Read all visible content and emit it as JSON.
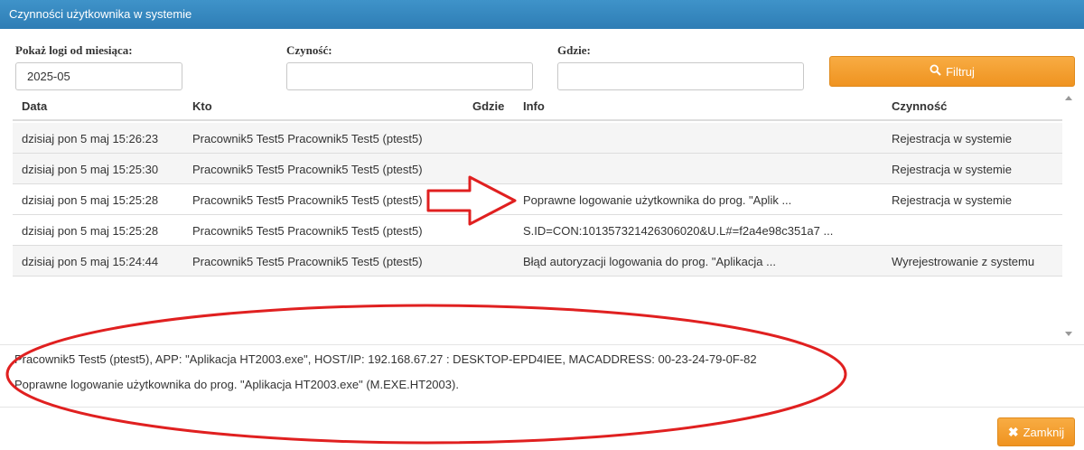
{
  "window": {
    "title": "Czynności użytkownika w systemie"
  },
  "filters": {
    "month_label": "Pokaż logi od miesiąca:",
    "month_value": "2025-05",
    "action_label": "Czyność:",
    "action_value": "",
    "where_label": "Gdzie:",
    "where_value": "",
    "filter_button": "Filtruj"
  },
  "table": {
    "headers": {
      "date": "Data",
      "who": "Kto",
      "where": "Gdzie",
      "info": "Info",
      "action": "Czynność"
    },
    "rows": [
      {
        "date": "dzisiaj pon 5 maj 15:26:23",
        "who": "Pracownik5 Test5 Pracownik5 Test5 (ptest5)",
        "where": "",
        "info": "",
        "action": "Rejestracja w systemie"
      },
      {
        "date": "dzisiaj pon 5 maj 15:25:30",
        "who": "Pracownik5 Test5 Pracownik5 Test5 (ptest5)",
        "where": "",
        "info": "",
        "action": "Rejestracja w systemie"
      },
      {
        "date": "dzisiaj pon 5 maj 15:25:28",
        "who": "Pracownik5 Test5 Pracownik5 Test5 (ptest5)",
        "where": "",
        "info": "Poprawne logowanie użytkownika do prog. \"Aplik ...",
        "action": "Rejestracja w systemie"
      },
      {
        "date": "dzisiaj pon 5 maj 15:25:28",
        "who": "Pracownik5 Test5 Pracownik5 Test5 (ptest5)",
        "where": "",
        "info": "S.ID=CON:101357321426306020&U.L#=f2a4e98c351a7 ...",
        "action": ""
      },
      {
        "date": "dzisiaj pon 5 maj 15:24:44",
        "who": "Pracownik5 Test5 Pracownik5 Test5 (ptest5)",
        "where": "",
        "info": "Błąd autoryzacji logowania do prog. \"Aplikacja ...",
        "action": "Wyrejestrowanie z systemu"
      }
    ]
  },
  "details": {
    "line1": "Pracownik5 Test5 (ptest5), APP: \"Aplikacja HT2003.exe\", HOST/IP: 192.168.67.27 : DESKTOP-EPD4IEE, MACADDRESS: 00-23-24-79-0F-82",
    "line2": "Poprawne logowanie użytkownika do prog. \"Aplikacja HT2003.exe\" (M.EXE.HT2003)."
  },
  "footer": {
    "close_button": "Zamknij"
  },
  "colors": {
    "titlebar": "#3380bd",
    "button": "#f0ad4e",
    "annotation": "#e02020"
  }
}
